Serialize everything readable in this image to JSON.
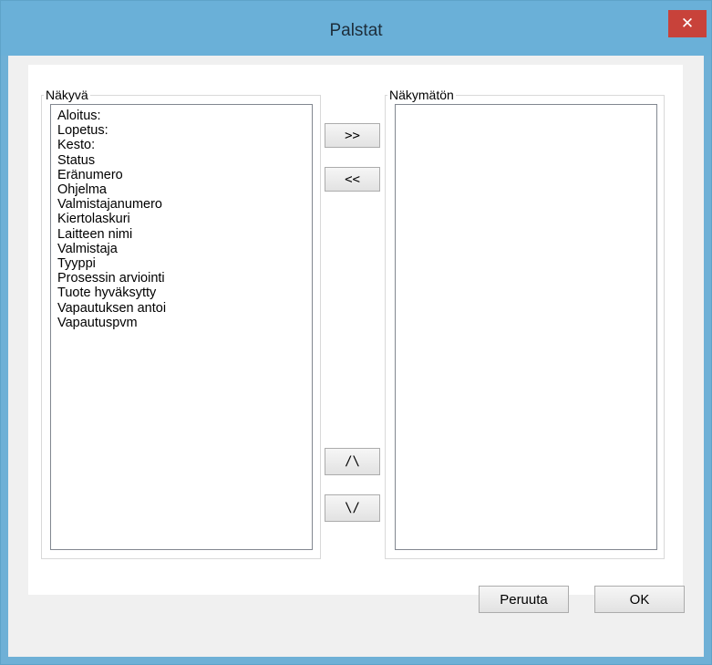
{
  "window": {
    "title": "Palstat",
    "close_icon": "✕"
  },
  "visible_group": {
    "label": "Näkyvä",
    "items": [
      "Aloitus:",
      "Lopetus:",
      "Kesto:",
      "Status",
      "Eränumero",
      "Ohjelma",
      "Valmistajanumero",
      "Kiertolaskuri",
      "Laitteen nimi",
      "Valmistaja",
      "Tyyppi",
      "Prosessin arviointi",
      "Tuote hyväksytty",
      "Vapautuksen antoi",
      "Vapautuspvm"
    ]
  },
  "hidden_group": {
    "label": "Näkymätön",
    "items": []
  },
  "buttons": {
    "move_right": ">>",
    "move_left": "<<",
    "move_up": "/\\",
    "move_down": "\\/",
    "cancel": "Peruuta",
    "ok": "OK"
  }
}
